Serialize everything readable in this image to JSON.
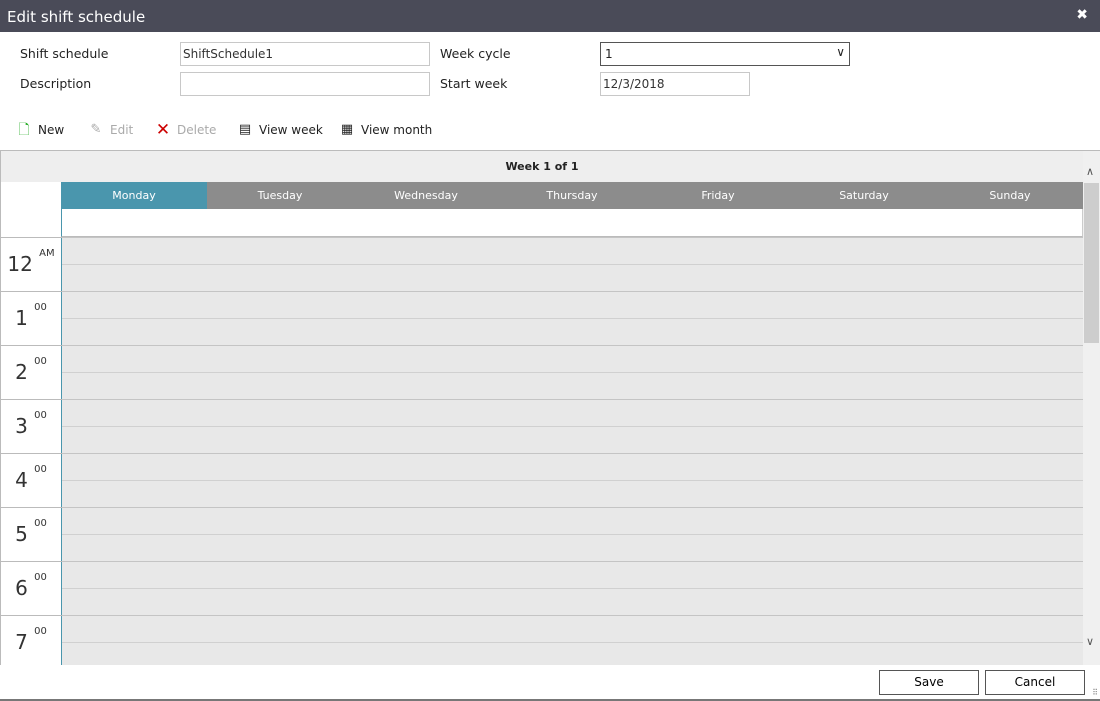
{
  "title": "Edit shift schedule",
  "form": {
    "shift_schedule_label": "Shift schedule",
    "shift_schedule_value": "ShiftSchedule1",
    "description_label": "Description",
    "description_value": "",
    "week_cycle_label": "Week cycle",
    "week_cycle_value": "1",
    "start_week_label": "Start week",
    "start_week_value": "12/3/2018"
  },
  "toolbar": {
    "new": "New",
    "edit": "Edit",
    "delete": "Delete",
    "view_week": "View week",
    "view_month": "View month"
  },
  "calendar": {
    "week_header": "Week 1 of 1",
    "days": [
      "Monday",
      "Tuesday",
      "Wednesday",
      "Thursday",
      "Friday",
      "Saturday",
      "Sunday"
    ],
    "active_day": "Monday",
    "hours": [
      {
        "h": "12",
        "s": "AM"
      },
      {
        "h": "1",
        "s": "00"
      },
      {
        "h": "2",
        "s": "00"
      },
      {
        "h": "3",
        "s": "00"
      },
      {
        "h": "4",
        "s": "00"
      },
      {
        "h": "5",
        "s": "00"
      },
      {
        "h": "6",
        "s": "00"
      },
      {
        "h": "7",
        "s": "00"
      }
    ]
  },
  "footer": {
    "save": "Save",
    "cancel": "Cancel"
  },
  "colors": {
    "titlebar": "#4a4b58",
    "active_day": "#4a96ad",
    "day_header": "#8c8c8c"
  }
}
